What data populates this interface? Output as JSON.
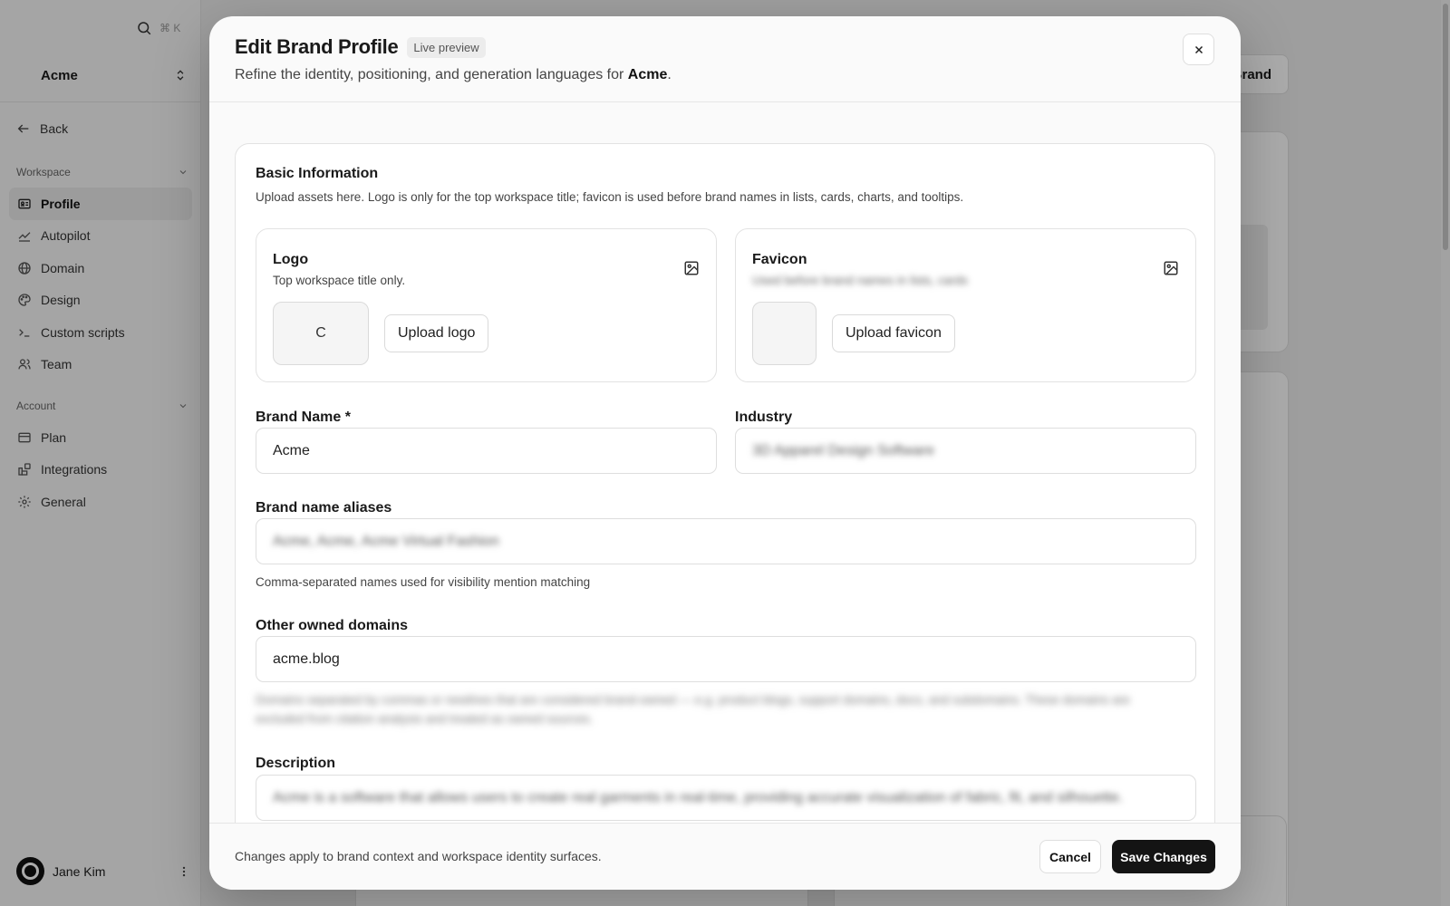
{
  "app": {
    "search_shortcut": "⌘ K",
    "workspace_name": "Acme",
    "back_label": "Back",
    "sections": [
      {
        "title": "Workspace",
        "items": [
          {
            "label": "Profile",
            "icon": "id-card-icon",
            "active": true
          },
          {
            "label": "Autopilot",
            "icon": "chart-line-icon"
          },
          {
            "label": "Domain",
            "icon": "globe-icon"
          },
          {
            "label": "Design",
            "icon": "palette-icon"
          },
          {
            "label": "Custom scripts",
            "icon": "terminal-icon"
          },
          {
            "label": "Team",
            "icon": "users-icon"
          }
        ]
      },
      {
        "title": "Account",
        "items": [
          {
            "label": "Plan",
            "icon": "credit-card-icon"
          },
          {
            "label": "Integrations",
            "icon": "blocks-icon"
          },
          {
            "label": "General",
            "icon": "gear-icon"
          }
        ]
      }
    ],
    "user_name": "Jane Kim",
    "header_button_label": "Brand"
  },
  "modal": {
    "title": "Edit Brand Profile",
    "badge": "Live preview",
    "subtitle_prefix": "Refine the identity, positioning, and generation languages for ",
    "subtitle_brand": "Acme",
    "subtitle_suffix": ".",
    "close_icon": "close-icon",
    "basic_info": {
      "title": "Basic Information",
      "description": "Upload assets here. Logo is only for the top workspace title; favicon is used before brand names in lists, cards, charts, and tooltips."
    },
    "logo": {
      "title": "Logo",
      "subtitle": "Top workspace title only.",
      "placeholder_letter": "C",
      "upload_label": "Upload logo",
      "icon": "image-icon"
    },
    "favicon": {
      "title": "Favicon",
      "subtitle": "Used before brand names in lists, cards",
      "upload_label": "Upload favicon",
      "icon": "image-icon"
    },
    "fields": {
      "brand_name_label": "Brand Name *",
      "brand_name_value": "Acme",
      "industry_label": "Industry",
      "industry_value": "3D Apparel Design Software",
      "aliases_label": "Brand name aliases",
      "aliases_value": "Acme, Acme, Acme Virtual Fashion",
      "aliases_help": "Comma-separated names used for visibility mention matching",
      "domains_label": "Other owned domains",
      "domains_value": "acme.blog",
      "domains_help": "Domains separated by commas or newlines that are considered brand-owned — e.g. product blogs, support domains, docs, and subdomains. These domains are excluded from citation analysis and treated as owned sources.",
      "description_label": "Description",
      "description_value": "Acme is a software that allows users to create real garments in real-time, providing accurate visualization of fabric, fit, and silhouette."
    },
    "footer_note": "Changes apply to brand context and workspace identity surfaces.",
    "cancel_label": "Cancel",
    "save_label": "Save Changes"
  }
}
